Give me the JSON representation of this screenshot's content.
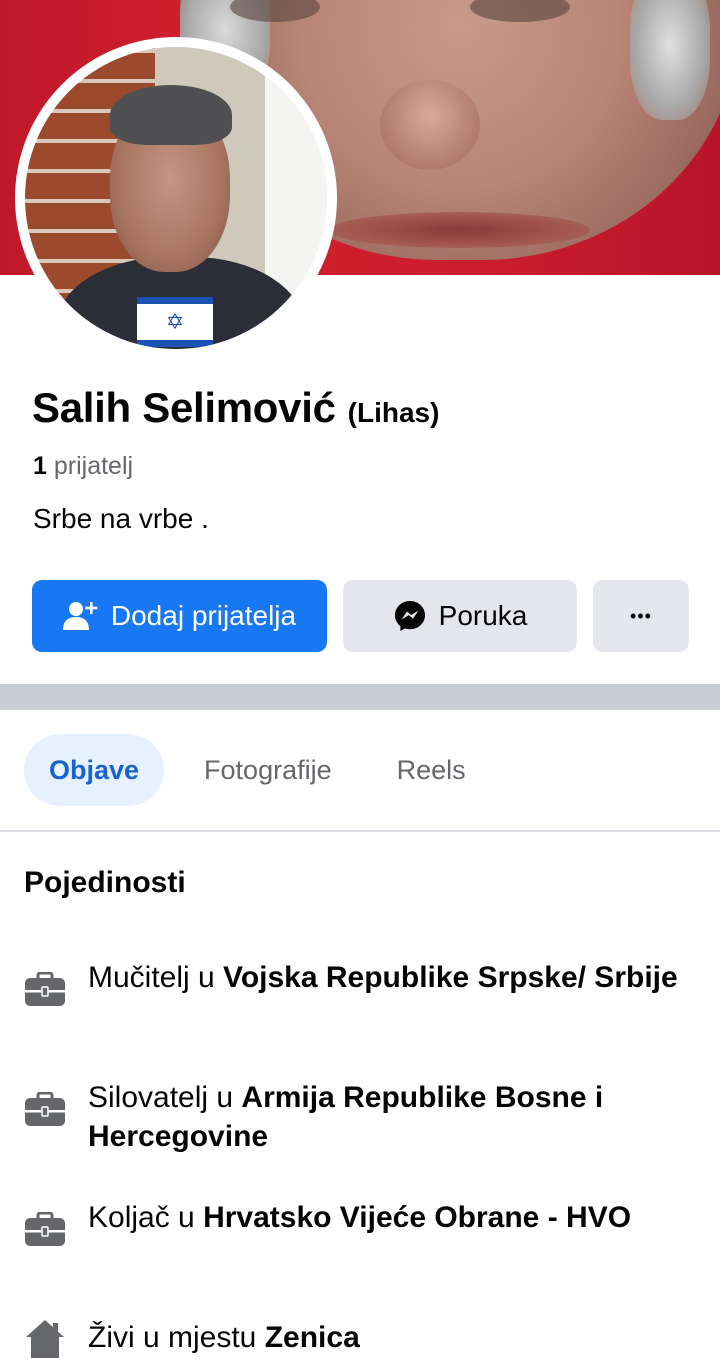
{
  "profile": {
    "name": "Salih Selimović",
    "alternate_name": "(Lihas)",
    "friends_count": "1",
    "friends_label": "prijatelj",
    "bio": "Srbe na vrbe ."
  },
  "actions": {
    "add_friend_label": "Dodaj prijatelja",
    "message_label": "Poruka",
    "more_label": "•••"
  },
  "tabs": [
    {
      "label": "Objave",
      "active": true
    },
    {
      "label": "Fotografije",
      "active": false
    },
    {
      "label": "Reels",
      "active": false
    }
  ],
  "details": {
    "title": "Pojedinosti",
    "items": [
      {
        "icon": "briefcase-icon",
        "prefix": "Mučitelj u ",
        "bold": "Vojska Republike Srpske/ Srbije"
      },
      {
        "icon": "briefcase-icon",
        "prefix": "Silovatelj u ",
        "bold": "Armija Republike Bosne i Hercegovine"
      },
      {
        "icon": "briefcase-icon",
        "prefix": "Koljač u ",
        "bold": "Hrvatsko Vijeće Obrane - HVO"
      },
      {
        "icon": "home-icon",
        "prefix": "Živi u mjestu ",
        "bold": "Zenica"
      }
    ]
  },
  "colors": {
    "primary_button": "#1877f2",
    "secondary_button": "#e4e6eb",
    "active_tab_bg": "#e7f0fd",
    "active_tab_text": "#1763cf"
  }
}
